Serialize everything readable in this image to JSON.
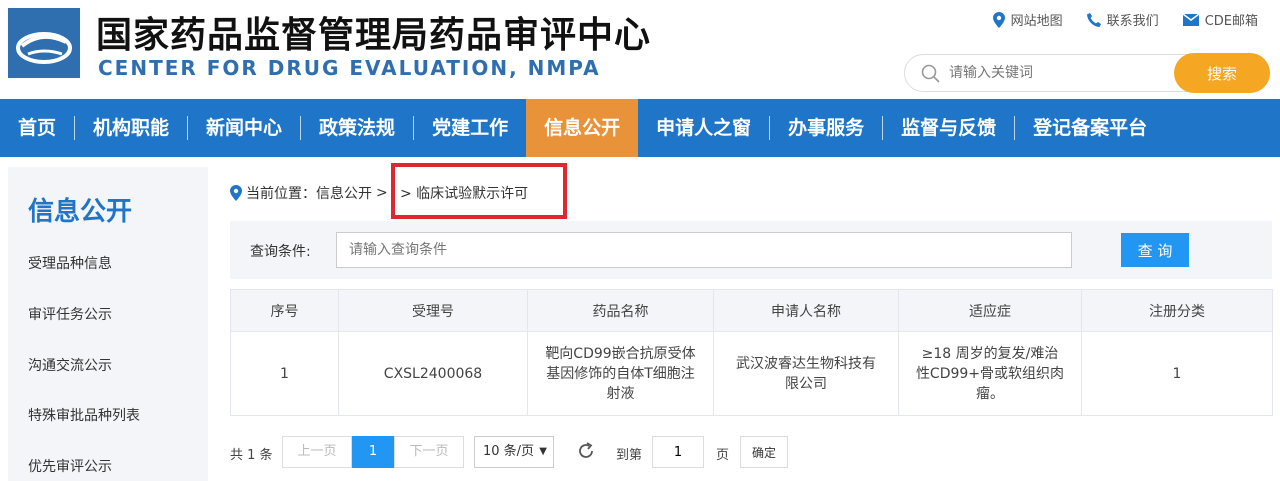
{
  "header": {
    "title_cn": "国家药品监督管理局药品审评中心",
    "title_en": "CENTER FOR DRUG EVALUATION, NMPA",
    "links": [
      {
        "label": "网站地图",
        "icon": "location-pin-icon"
      },
      {
        "label": "联系我们",
        "icon": "phone-icon"
      },
      {
        "label": "CDE邮箱",
        "icon": "mail-icon"
      }
    ],
    "search_placeholder": "请输入关键词",
    "search_button": "搜索"
  },
  "nav": {
    "items": [
      "首页",
      "机构职能",
      "新闻中心",
      "政策法规",
      "党建工作",
      "信息公开",
      "申请人之窗",
      "办事服务",
      "监督与反馈",
      "登记备案平台"
    ],
    "active_index": 5
  },
  "sidebar": {
    "title": "信息公开",
    "items": [
      "受理品种信息",
      "审评任务公示",
      "沟通交流公示",
      "特殊审批品种列表",
      "优先审评公示"
    ]
  },
  "breadcrumb": {
    "prefix": "当前位置：信息公开",
    "separator": ">",
    "current": "> 临床试验默示许可"
  },
  "query": {
    "label": "查询条件:",
    "placeholder": "请输入查询条件",
    "button": "查 询"
  },
  "table": {
    "headers": [
      "序号",
      "受理号",
      "药品名称",
      "申请人名称",
      "适应症",
      "注册分类"
    ],
    "rows": [
      [
        "1",
        "CXSL2400068",
        "靶向CD99嵌合抗原受体基因修饰的自体T细胞注射液",
        "武汉波睿达生物科技有限公司",
        "≥18 周岁的复发/难治性CD99+骨或软组织肉瘤。",
        "1"
      ]
    ]
  },
  "pager": {
    "total": "共 1 条",
    "prev": "上一页",
    "current_page": "1",
    "next": "下一页",
    "page_size": "10 条/页",
    "goto_label": "到第",
    "goto_value": "1",
    "page_unit": "页",
    "confirm": "确定"
  },
  "colors": {
    "brand_blue": "#1f75c7",
    "active_orange": "#e8923a",
    "search_orange": "#f5a623",
    "button_blue": "#2196f3",
    "highlight_red": "#e0262e"
  }
}
